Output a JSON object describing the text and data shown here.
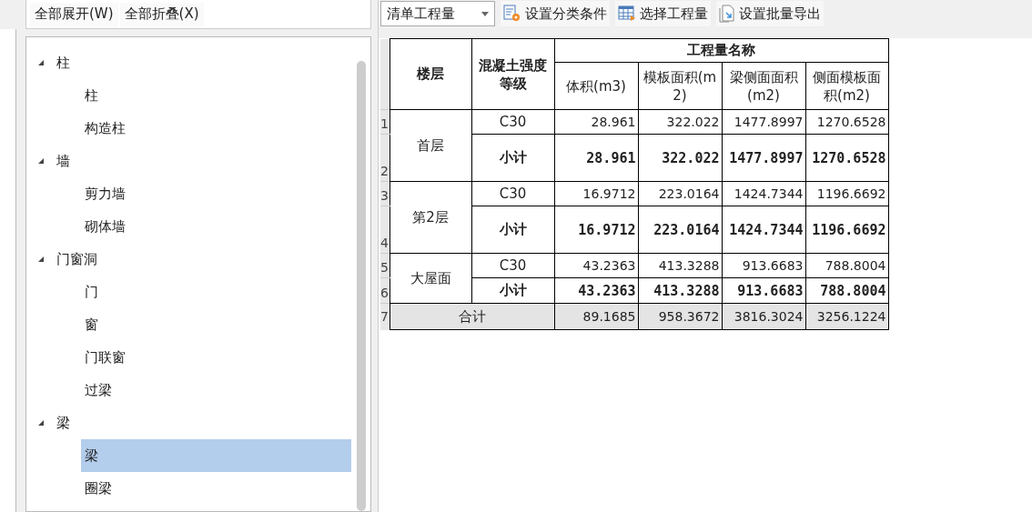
{
  "left_toolbar": {
    "buttons": [
      "全部展开(W)",
      "全部折叠(X)"
    ]
  },
  "tree": [
    {
      "label": "柱",
      "expanded": true,
      "selected": false,
      "children": [
        {
          "label": "柱",
          "selected": false
        },
        {
          "label": "构造柱",
          "selected": false
        }
      ]
    },
    {
      "label": "墙",
      "expanded": true,
      "selected": false,
      "children": [
        {
          "label": "剪力墙",
          "selected": false
        },
        {
          "label": "砌体墙",
          "selected": false
        }
      ]
    },
    {
      "label": "门窗洞",
      "expanded": true,
      "selected": false,
      "children": [
        {
          "label": "门",
          "selected": false
        },
        {
          "label": "窗",
          "selected": false
        },
        {
          "label": "门联窗",
          "selected": false
        },
        {
          "label": "过梁",
          "selected": false
        }
      ]
    },
    {
      "label": "梁",
      "expanded": true,
      "selected": false,
      "children": [
        {
          "label": "梁",
          "selected": true
        },
        {
          "label": "圈梁",
          "selected": false
        }
      ]
    }
  ],
  "right_toolbar": {
    "dropdown": "清单工程量",
    "buttons": [
      {
        "kind": "gear",
        "label": "设置分类条件"
      },
      {
        "kind": "grid",
        "label": "选择工程量"
      },
      {
        "kind": "export",
        "label": "设置批量导出"
      }
    ]
  },
  "table": {
    "columns": [
      "楼层",
      "混凝土强度等级"
    ],
    "group_header": "工程量名称",
    "sub_columns": [
      "体积(m3)",
      "模板面积(m2)",
      "梁侧面面积(m2)",
      "侧面模板面积(m2)"
    ],
    "groups": [
      {
        "floor": "首层",
        "rows": [
          {
            "num": "1",
            "kind": "normal",
            "grade": "C30",
            "values": [
              "28.961",
              "322.022",
              "1477.8997",
              "1270.6528"
            ]
          },
          {
            "num": "2",
            "kind": "subtotal",
            "grade": "小计",
            "values": [
              "28.961",
              "322.022",
              "1477.8997",
              "1270.6528"
            ]
          }
        ]
      },
      {
        "floor": "第2层",
        "rows": [
          {
            "num": "3",
            "kind": "normal",
            "grade": "C30",
            "values": [
              "16.9712",
              "223.0164",
              "1424.7344",
              "1196.6692"
            ]
          },
          {
            "num": "4",
            "kind": "subtotal",
            "grade": "小计",
            "values": [
              "16.9712",
              "223.0164",
              "1424.7344",
              "1196.6692"
            ]
          }
        ]
      },
      {
        "floor": "大屋面",
        "rows": [
          {
            "num": "5",
            "kind": "normal",
            "grade": "C30",
            "values": [
              "43.2363",
              "413.3288",
              "913.6683",
              "788.8004"
            ]
          },
          {
            "num": "6",
            "kind": "subtotal",
            "grade": "小计",
            "values": [
              "43.2363",
              "413.3288",
              "913.6683",
              "788.8004"
            ]
          }
        ]
      }
    ],
    "total": {
      "num": "7",
      "label": "合计",
      "values": [
        "89.1685",
        "958.3672",
        "3816.3024",
        "3256.1224"
      ]
    }
  }
}
